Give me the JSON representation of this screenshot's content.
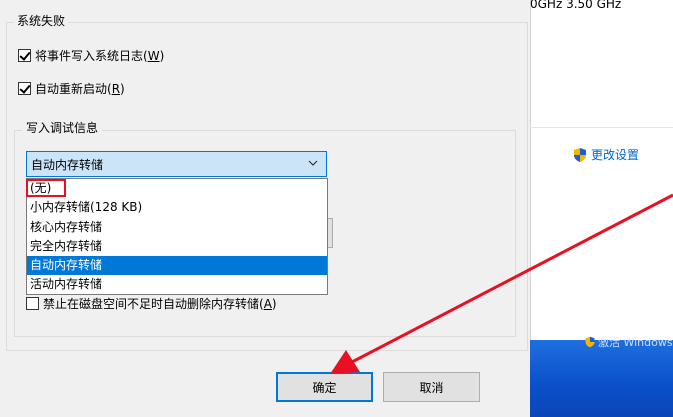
{
  "dialog": {
    "group_title": "系统失败",
    "write_event_log": {
      "label_main": "将事件写入系统日志(",
      "label_key": "W",
      "label_end": ")",
      "checked": true
    },
    "auto_restart": {
      "label_main": "自动重新启动(",
      "label_key": "R",
      "label_end": ")",
      "checked": true
    },
    "debug_group_title": "写入调试信息",
    "dump_select": {
      "selected": "自动内存转储",
      "options": [
        "(无)",
        "小内存转储(128 KB)",
        "核心内存转储",
        "完全内存转储",
        "自动内存转储",
        "活动内存转储"
      ],
      "highlighted_index": 4
    },
    "disable_auto_delete": {
      "label_main": "禁止在磁盘空间不足时自动删除内存转储(",
      "label_key": "A",
      "label_end": ")",
      "checked": false
    },
    "ok_label": "确定",
    "cancel_label": "取消"
  },
  "background": {
    "speed_text": "0GHz   3.50 GHz",
    "change_settings": "更改设置",
    "taskbar_text": "激活 Windows"
  },
  "colors": {
    "accent": "#0078d7",
    "annotation_red": "#e81123",
    "link": "#0066cc"
  }
}
